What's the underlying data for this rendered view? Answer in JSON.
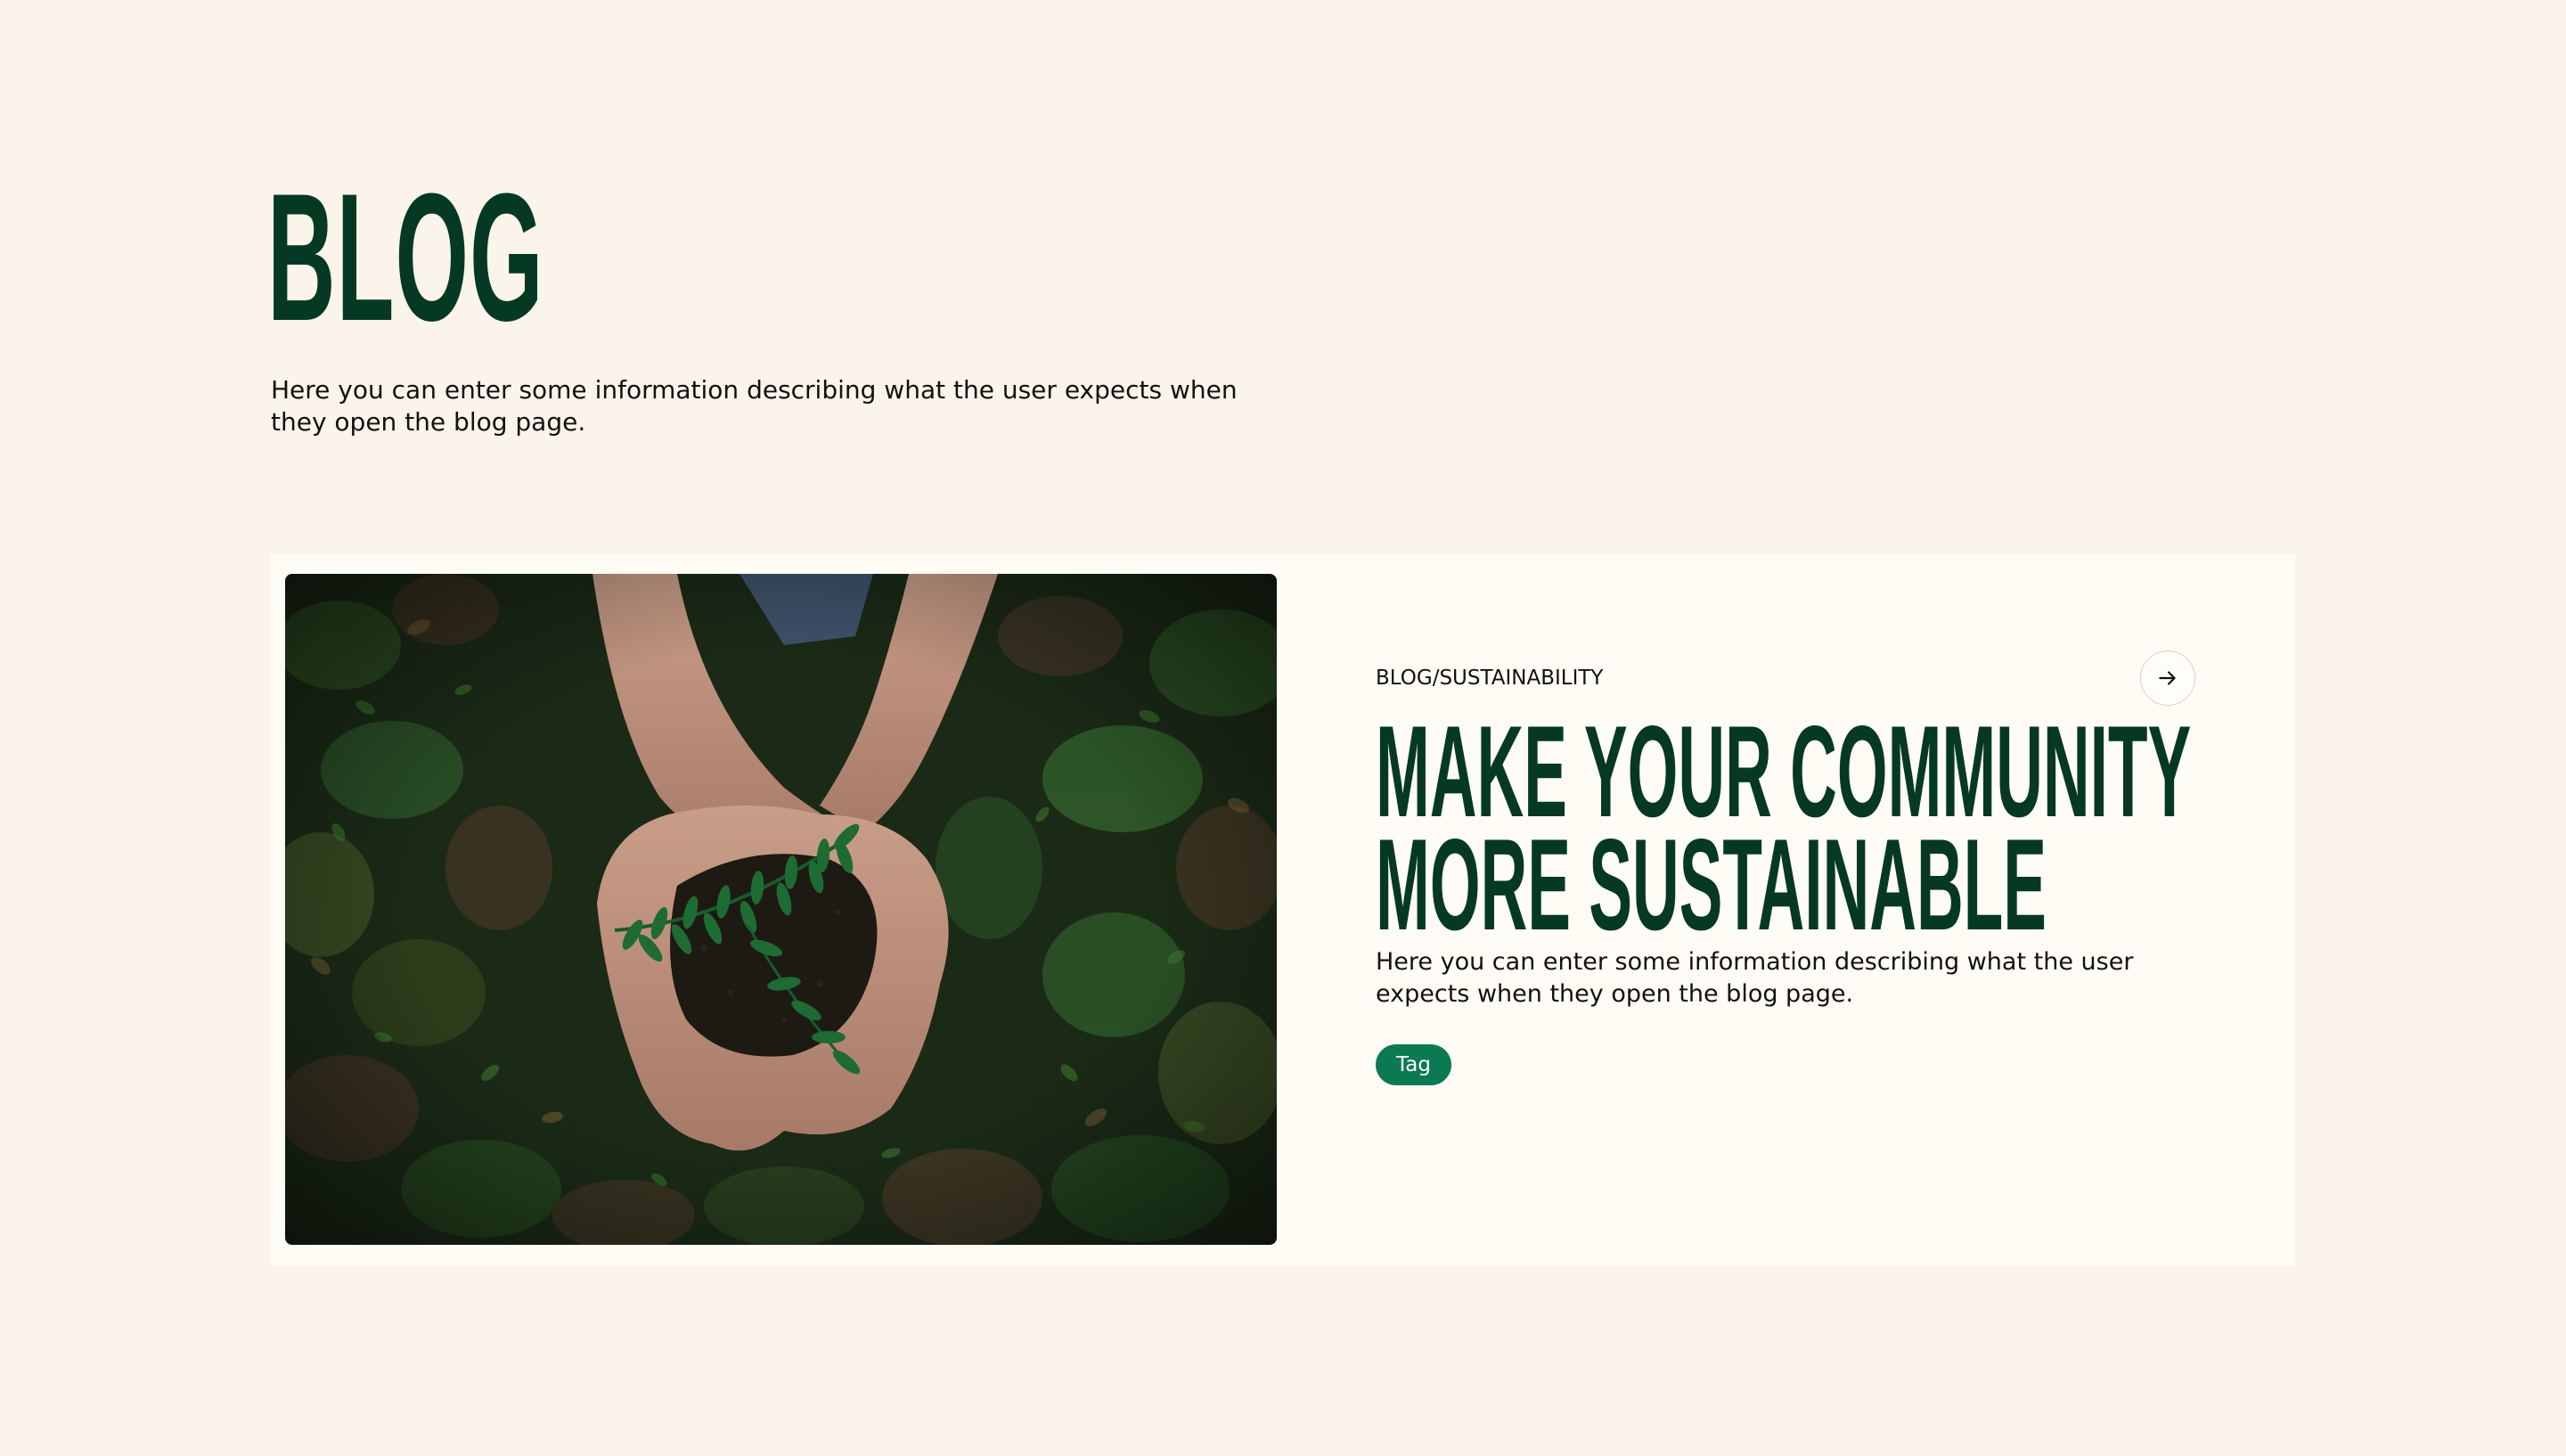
{
  "header": {
    "title": "BLOG",
    "intro": "Here you can enter some information describing what the user expects when they open the blog page."
  },
  "post": {
    "breadcrumb": "BLOG/SUSTAINABILITY",
    "title_line1": "MAKE YOUR COMMUNITY",
    "title_line2": "MORE SUSTAINABLE",
    "description": "Here you can enter some information describing what the user expects when they open the blog page.",
    "tag": "Tag",
    "arrow_icon": "arrow-right-icon",
    "image_subject": "hands-holding-seedling"
  },
  "colors": {
    "page_background": "#faf4ea",
    "card_background": "#fffbf5",
    "heading": "#063923",
    "tag_background": "#0b7a52",
    "text": "#111111"
  }
}
